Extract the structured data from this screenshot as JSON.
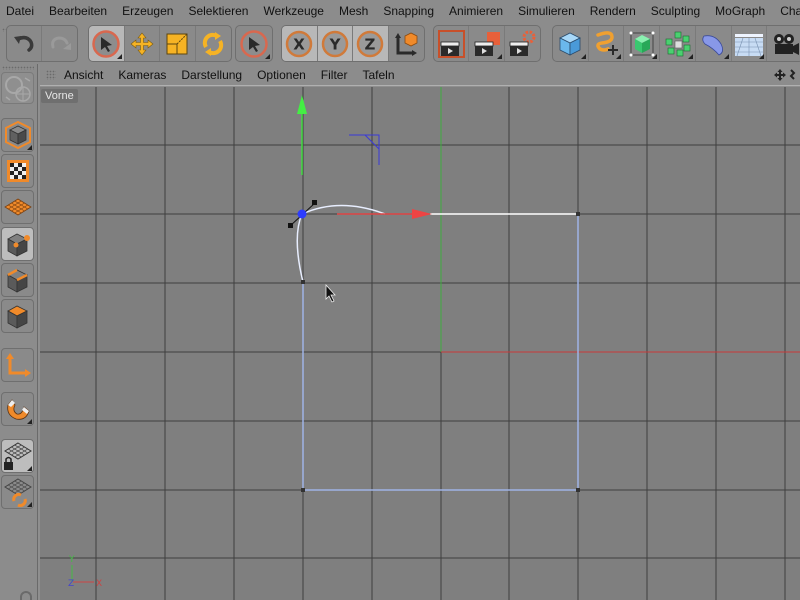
{
  "menubar": {
    "items": [
      "Datei",
      "Bearbeiten",
      "Erzeugen",
      "Selektieren",
      "Werkzeuge",
      "Mesh",
      "Snapping",
      "Animieren",
      "Simulieren",
      "Rendern",
      "Sculpting",
      "MoGraph",
      "Charak"
    ]
  },
  "toolbar": {
    "history": [
      {
        "icon": "undo-icon",
        "label": "Undo"
      },
      {
        "icon": "redo-icon",
        "label": "Redo",
        "disabled": true
      }
    ],
    "tools": [
      {
        "icon": "live-selection-icon",
        "label": "Live Selection",
        "active": true
      },
      {
        "icon": "move-icon",
        "label": "Move"
      },
      {
        "icon": "scale-icon",
        "label": "Scale"
      },
      {
        "icon": "rotate-icon",
        "label": "Rotate"
      }
    ],
    "last_tool": {
      "icon": "selection-tool-icon",
      "label": "Last Tool"
    },
    "axes": [
      {
        "icon": "x-axis-lock-icon",
        "label": "X"
      },
      {
        "icon": "y-axis-lock-icon",
        "label": "Y"
      },
      {
        "icon": "z-axis-lock-icon",
        "label": "Z"
      },
      {
        "icon": "coordinate-system-icon",
        "label": "World/Object Coordinate System"
      }
    ],
    "render": [
      {
        "icon": "render-view-icon",
        "label": "Render View"
      },
      {
        "icon": "render-picture-viewer-icon",
        "label": "Render to Picture Viewer"
      },
      {
        "icon": "render-settings-icon",
        "label": "Render Settings"
      }
    ],
    "create": [
      {
        "icon": "cube-icon",
        "label": "Cube"
      },
      {
        "icon": "spline-pen-icon",
        "label": "Spline"
      },
      {
        "icon": "subdivision-surface-icon",
        "label": "Subdivision Surface"
      },
      {
        "icon": "cloner-icon",
        "label": "Cloner"
      },
      {
        "icon": "bend-deformer-icon",
        "label": "Deformer"
      },
      {
        "icon": "floor-icon",
        "label": "Environment"
      },
      {
        "icon": "camera-icon",
        "label": "Camera"
      }
    ]
  },
  "left_palette": {
    "items": [
      {
        "icon": "make-editable-icon",
        "label": "Make Editable"
      },
      {
        "icon": "model-mode-icon",
        "label": "Model"
      },
      {
        "icon": "texture-mode-icon",
        "label": "Texture"
      },
      {
        "icon": "workplane-icon",
        "label": "Workplane"
      },
      {
        "icon": "points-mode-icon",
        "label": "Points",
        "active": true
      },
      {
        "icon": "edges-mode-icon",
        "label": "Edges"
      },
      {
        "icon": "polygons-mode-icon",
        "label": "Polygons"
      },
      {
        "icon": "axis-mode-icon",
        "label": "Enable Axis"
      },
      {
        "icon": "snapping-icon",
        "label": "Snapping"
      },
      {
        "icon": "locked-workplane-icon",
        "label": "Locked Workplane",
        "active": true
      },
      {
        "icon": "planar-workplane-icon",
        "label": "Planar Workplane"
      }
    ]
  },
  "viewport": {
    "menu": [
      "Ansicht",
      "Kameras",
      "Darstellung",
      "Optionen",
      "Filter",
      "Tafeln"
    ],
    "view_name": "Vorne",
    "axis_labels": {
      "y": "Y",
      "x": "X",
      "z": "Z"
    },
    "colors": {
      "background": "#7f7f7f",
      "grid": "#3f3f3f",
      "world_x": "#c83a3a",
      "world_y": "#3fae3f",
      "spline": "#9fb4e6",
      "selected_spline": "#ffffff",
      "point_selected": "#2d3cff"
    }
  }
}
